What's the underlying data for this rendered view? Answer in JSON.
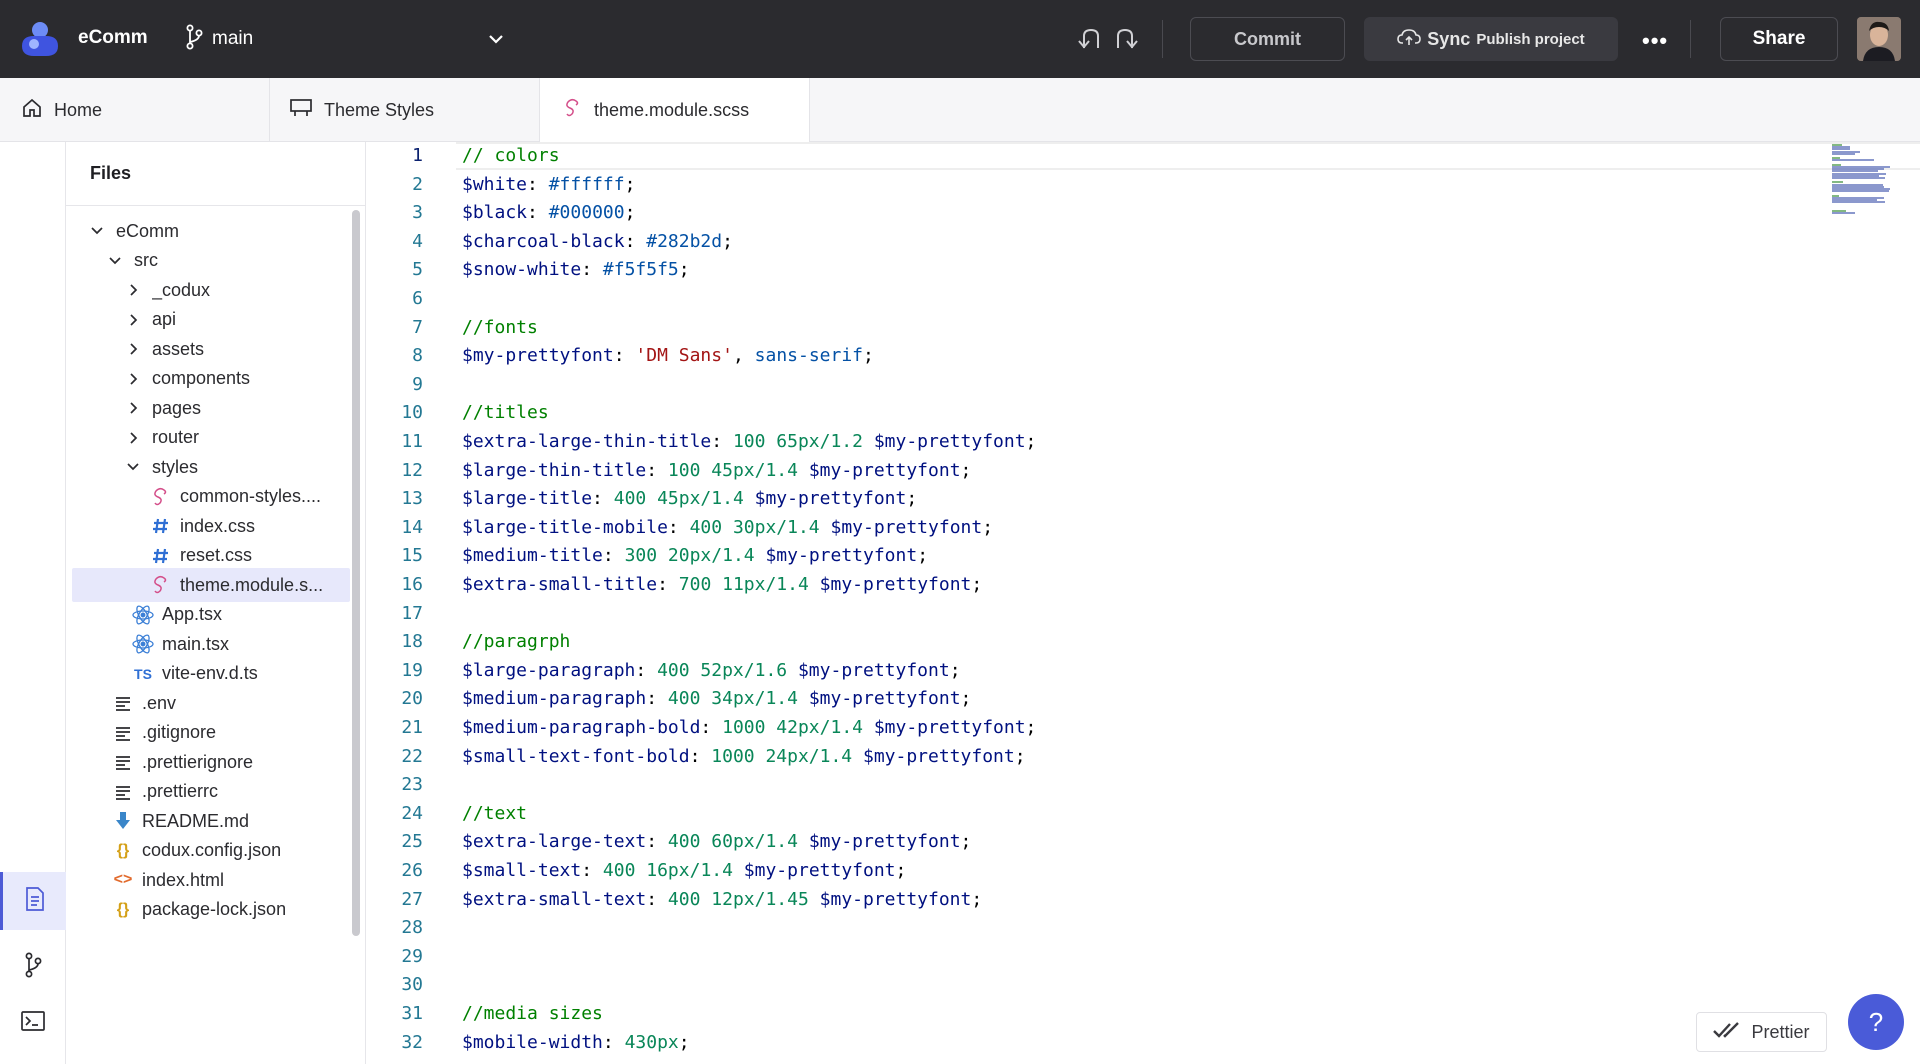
{
  "topbar": {
    "app_name": "eComm",
    "branch": "main",
    "commit_label": "Commit",
    "sync_label": "Sync",
    "sync_sub_label": "Publish project",
    "more_label": "•••",
    "share_label": "Share"
  },
  "tabs": [
    {
      "label": "Home"
    },
    {
      "label": "Theme Styles"
    },
    {
      "label": "theme.module.scss"
    }
  ],
  "files": {
    "header": "Files",
    "tree": [
      {
        "label": "eComm",
        "icon": "chevron-down-icon"
      },
      {
        "label": "src",
        "icon": "chevron-down-icon"
      },
      {
        "label": "_codux",
        "icon": "chevron-right-icon"
      },
      {
        "label": "api",
        "icon": "chevron-right-icon"
      },
      {
        "label": "assets",
        "icon": "chevron-right-icon"
      },
      {
        "label": "components",
        "icon": "chevron-right-icon"
      },
      {
        "label": "pages",
        "icon": "chevron-right-icon"
      },
      {
        "label": "router",
        "icon": "chevron-right-icon"
      },
      {
        "label": "styles",
        "icon": "chevron-down-icon"
      },
      {
        "label": "common-styles....",
        "icon": "scss-icon"
      },
      {
        "label": "index.css",
        "icon": "css-hash-icon"
      },
      {
        "label": "reset.css",
        "icon": "css-hash-icon"
      },
      {
        "label": "theme.module.s...",
        "icon": "scss-icon"
      },
      {
        "label": "App.tsx",
        "icon": "react-icon"
      },
      {
        "label": "main.tsx",
        "icon": "react-icon"
      },
      {
        "label": "vite-env.d.ts",
        "icon": "ts-icon",
        "icon_text": "TS"
      },
      {
        "label": ".env",
        "icon": "text-file-icon"
      },
      {
        "label": ".gitignore",
        "icon": "text-file-icon"
      },
      {
        "label": ".prettierignore",
        "icon": "text-file-icon"
      },
      {
        "label": ".prettierrc",
        "icon": "text-file-icon"
      },
      {
        "label": "README.md",
        "icon": "markdown-icon"
      },
      {
        "label": "codux.config.json",
        "icon": "json-icon",
        "icon_text": "{}"
      },
      {
        "label": "index.html",
        "icon": "html-icon",
        "icon_text": "<>"
      },
      {
        "label": "package-lock.json",
        "icon": "json-icon",
        "icon_text": "{}"
      }
    ]
  },
  "editor": {
    "lines": [
      {
        "n": "1",
        "tokens": [
          [
            "c",
            "// colors"
          ]
        ]
      },
      {
        "n": "2",
        "tokens": [
          [
            "v",
            "$white"
          ],
          [
            "p",
            ": "
          ],
          [
            "k",
            "#ffffff"
          ],
          [
            "p",
            ";"
          ]
        ]
      },
      {
        "n": "3",
        "tokens": [
          [
            "v",
            "$black"
          ],
          [
            "p",
            ": "
          ],
          [
            "k",
            "#000000"
          ],
          [
            "p",
            ";"
          ]
        ]
      },
      {
        "n": "4",
        "tokens": [
          [
            "v",
            "$charcoal-black"
          ],
          [
            "p",
            ": "
          ],
          [
            "k",
            "#282b2d"
          ],
          [
            "p",
            ";"
          ]
        ]
      },
      {
        "n": "5",
        "tokens": [
          [
            "v",
            "$snow-white"
          ],
          [
            "p",
            ": "
          ],
          [
            "k",
            "#f5f5f5"
          ],
          [
            "p",
            ";"
          ]
        ]
      },
      {
        "n": "6",
        "tokens": []
      },
      {
        "n": "7",
        "tokens": [
          [
            "c",
            "//fonts"
          ]
        ]
      },
      {
        "n": "8",
        "tokens": [
          [
            "v",
            "$my-prettyfont"
          ],
          [
            "p",
            ": "
          ],
          [
            "s",
            "'DM Sans'"
          ],
          [
            "p",
            ", "
          ],
          [
            "k",
            "sans-serif"
          ],
          [
            "p",
            ";"
          ]
        ]
      },
      {
        "n": "9",
        "tokens": []
      },
      {
        "n": "10",
        "tokens": [
          [
            "c",
            "//titles"
          ]
        ]
      },
      {
        "n": "11",
        "tokens": [
          [
            "v",
            "$extra-large-thin-title"
          ],
          [
            "p",
            ": "
          ],
          [
            "n",
            "100 65px/1.2 "
          ],
          [
            "v",
            "$my-prettyfont"
          ],
          [
            "p",
            ";"
          ]
        ]
      },
      {
        "n": "12",
        "tokens": [
          [
            "v",
            "$large-thin-title"
          ],
          [
            "p",
            ": "
          ],
          [
            "n",
            "100 45px/1.4 "
          ],
          [
            "v",
            "$my-prettyfont"
          ],
          [
            "p",
            ";"
          ]
        ]
      },
      {
        "n": "13",
        "tokens": [
          [
            "v",
            "$large-title"
          ],
          [
            "p",
            ": "
          ],
          [
            "n",
            "400 45px/1.4 "
          ],
          [
            "v",
            "$my-prettyfont"
          ],
          [
            "p",
            ";"
          ]
        ]
      },
      {
        "n": "14",
        "tokens": [
          [
            "v",
            "$large-title-mobile"
          ],
          [
            "p",
            ": "
          ],
          [
            "n",
            "400 30px/1.4 "
          ],
          [
            "v",
            "$my-prettyfont"
          ],
          [
            "p",
            ";"
          ]
        ]
      },
      {
        "n": "15",
        "tokens": [
          [
            "v",
            "$medium-title"
          ],
          [
            "p",
            ": "
          ],
          [
            "n",
            "300 20px/1.4 "
          ],
          [
            "v",
            "$my-prettyfont"
          ],
          [
            "p",
            ";"
          ]
        ]
      },
      {
        "n": "16",
        "tokens": [
          [
            "v",
            "$extra-small-title"
          ],
          [
            "p",
            ": "
          ],
          [
            "n",
            "700 11px/1.4 "
          ],
          [
            "v",
            "$my-prettyfont"
          ],
          [
            "p",
            ";"
          ]
        ]
      },
      {
        "n": "17",
        "tokens": []
      },
      {
        "n": "18",
        "tokens": [
          [
            "c",
            "//paragrph"
          ]
        ]
      },
      {
        "n": "19",
        "tokens": [
          [
            "v",
            "$large-paragraph"
          ],
          [
            "p",
            ": "
          ],
          [
            "n",
            "400 52px/1.6 "
          ],
          [
            "v",
            "$my-prettyfont"
          ],
          [
            "p",
            ";"
          ]
        ]
      },
      {
        "n": "20",
        "tokens": [
          [
            "v",
            "$medium-paragraph"
          ],
          [
            "p",
            ": "
          ],
          [
            "n",
            "400 34px/1.4 "
          ],
          [
            "v",
            "$my-prettyfont"
          ],
          [
            "p",
            ";"
          ]
        ]
      },
      {
        "n": "21",
        "tokens": [
          [
            "v",
            "$medium-paragraph-bold"
          ],
          [
            "p",
            ": "
          ],
          [
            "n",
            "1000 42px/1.4 "
          ],
          [
            "v",
            "$my-prettyfont"
          ],
          [
            "p",
            ";"
          ]
        ]
      },
      {
        "n": "22",
        "tokens": [
          [
            "v",
            "$small-text-font-bold"
          ],
          [
            "p",
            ": "
          ],
          [
            "n",
            "1000 24px/1.4 "
          ],
          [
            "v",
            "$my-prettyfont"
          ],
          [
            "p",
            ";"
          ]
        ]
      },
      {
        "n": "23",
        "tokens": []
      },
      {
        "n": "24",
        "tokens": [
          [
            "c",
            "//text"
          ]
        ]
      },
      {
        "n": "25",
        "tokens": [
          [
            "v",
            "$extra-large-text"
          ],
          [
            "p",
            ": "
          ],
          [
            "n",
            "400 60px/1.4 "
          ],
          [
            "v",
            "$my-prettyfont"
          ],
          [
            "p",
            ";"
          ]
        ]
      },
      {
        "n": "26",
        "tokens": [
          [
            "v",
            "$small-text"
          ],
          [
            "p",
            ": "
          ],
          [
            "n",
            "400 16px/1.4 "
          ],
          [
            "v",
            "$my-prettyfont"
          ],
          [
            "p",
            ";"
          ]
        ]
      },
      {
        "n": "27",
        "tokens": [
          [
            "v",
            "$extra-small-text"
          ],
          [
            "p",
            ": "
          ],
          [
            "n",
            "400 12px/1.45 "
          ],
          [
            "v",
            "$my-prettyfont"
          ],
          [
            "p",
            ";"
          ]
        ]
      },
      {
        "n": "28",
        "tokens": []
      },
      {
        "n": "29",
        "tokens": []
      },
      {
        "n": "30",
        "tokens": []
      },
      {
        "n": "31",
        "tokens": [
          [
            "c",
            "//media sizes"
          ]
        ]
      },
      {
        "n": "32",
        "tokens": [
          [
            "v",
            "$mobile-width"
          ],
          [
            "p",
            ": "
          ],
          [
            "n",
            "430px"
          ],
          [
            "p",
            ";"
          ]
        ]
      }
    ]
  },
  "prettier_label": "Prettier",
  "help_label": "?",
  "colors": {
    "topbar_bg": "#2b2b2f",
    "accent": "#4a5bd8",
    "selected_bg": "#e7e8fb",
    "comment": "#008000",
    "variable": "#001080",
    "number": "#098658",
    "string": "#a31515",
    "keyword": "#0451a5"
  }
}
